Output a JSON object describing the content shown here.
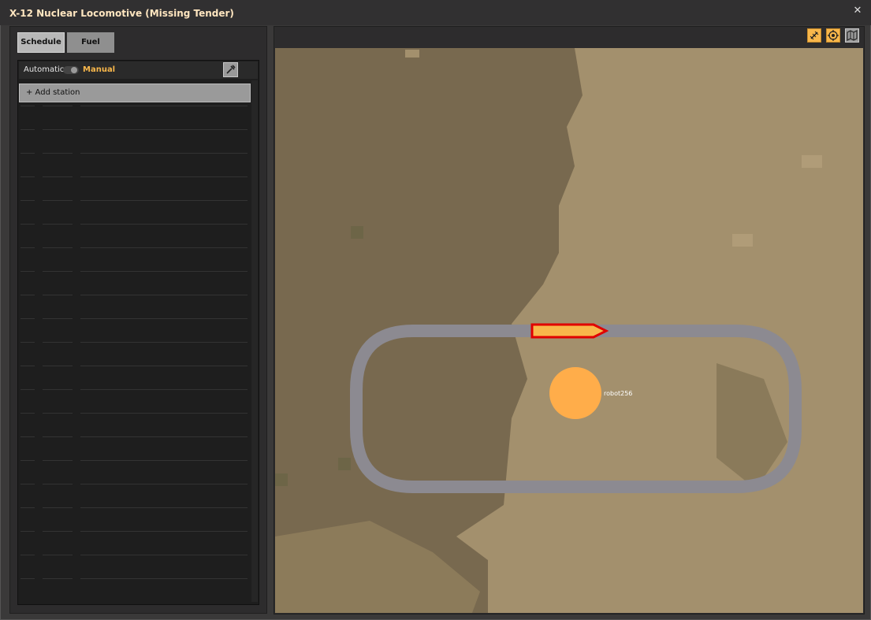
{
  "window": {
    "title": "X-12 Nuclear Locomotive (Missing Tender)",
    "close_glyph": "✕"
  },
  "tabs": [
    {
      "label": "Schedule",
      "active": true
    },
    {
      "label": "Fuel",
      "active": false
    }
  ],
  "mode": {
    "automatic_label": "Automatic",
    "manual_label": "Manual",
    "selected": "Manual"
  },
  "schedule": {
    "add_station_label": "+ Add station"
  },
  "map": {
    "player_name": "robot256",
    "icons": [
      "rail-icon",
      "locate-icon",
      "map-icon"
    ]
  },
  "colors": {
    "accent": "#f8b74b",
    "locomotive_fill": "#f8b74b",
    "locomotive_outline": "#e00000",
    "rail": "#8c8a91",
    "terrain_dark": "#78694f",
    "terrain_light": "#a3906d"
  }
}
